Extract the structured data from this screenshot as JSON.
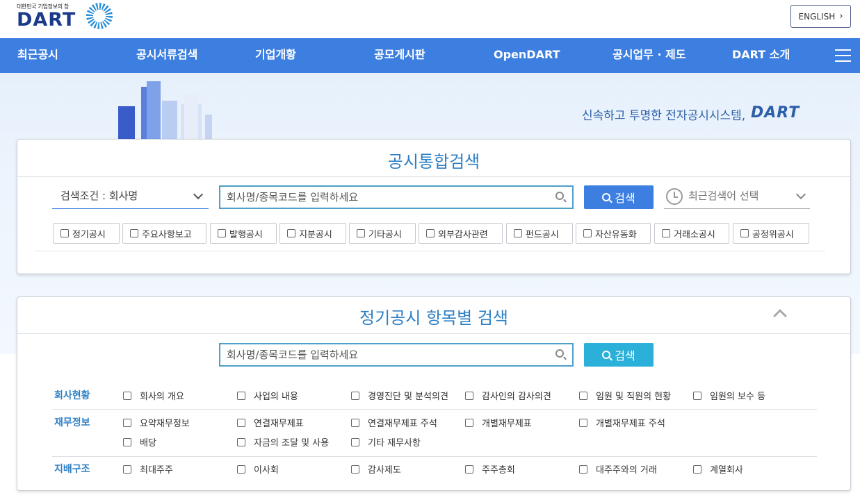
{
  "header": {
    "logo_tagline": "대한민국 기업정보의 창",
    "logo_text": "DART",
    "english_label": "ENGLISH"
  },
  "nav": {
    "items": [
      "최근공시",
      "공시서류검색",
      "기업개황",
      "공모게시판",
      "OpenDART",
      "공시업무 · 제도",
      "DART 소개"
    ]
  },
  "hero": {
    "slogan": "신속하고 투명한 전자공시시스템,",
    "slogan_brand": "DART"
  },
  "integrated_search": {
    "title": "공시통합검색",
    "condition_select": "검색조건 : 회사명",
    "placeholder": "회사명/종목코드를 입력하세요",
    "search_button": "검색",
    "recent_select": "최근검색어 선택",
    "categories": [
      "정기공시",
      "주요사항보고",
      "발행공시",
      "지분공시",
      "기타공시",
      "외부감사관련",
      "펀드공시",
      "자산유동화",
      "거래소공시",
      "공정위공시"
    ]
  },
  "periodic_search": {
    "title": "정기공시 항목별 검색",
    "placeholder": "회사명/종목코드를 입력하세요",
    "search_button": "검색",
    "groups": [
      {
        "label": "회사현황",
        "options": [
          "회사의 개요",
          "사업의 내용",
          "경영진단 및 분석의견",
          "감사인의 감사의견",
          "임원 및 직원의 현황",
          "임원의 보수 등"
        ]
      },
      {
        "label": "재무정보",
        "options": [
          "요약재무정보",
          "연결재무제표",
          "연결재무제표 주석",
          "개별재무제표",
          "개별재무제표 주석",
          "배당",
          "자금의 조달 및 사용",
          "기타 재무사항"
        ]
      },
      {
        "label": "지배구조",
        "options": [
          "최대주주",
          "이사회",
          "감사제도",
          "주주총회",
          "대주주와의 거래",
          "계열회사"
        ]
      }
    ]
  },
  "colors": {
    "nav_bg": "#3d7fe0",
    "title_blue": "#2c7fc4",
    "search_btn_primary": "#3d7fe0",
    "search_btn_secondary": "#2bb0d9"
  }
}
